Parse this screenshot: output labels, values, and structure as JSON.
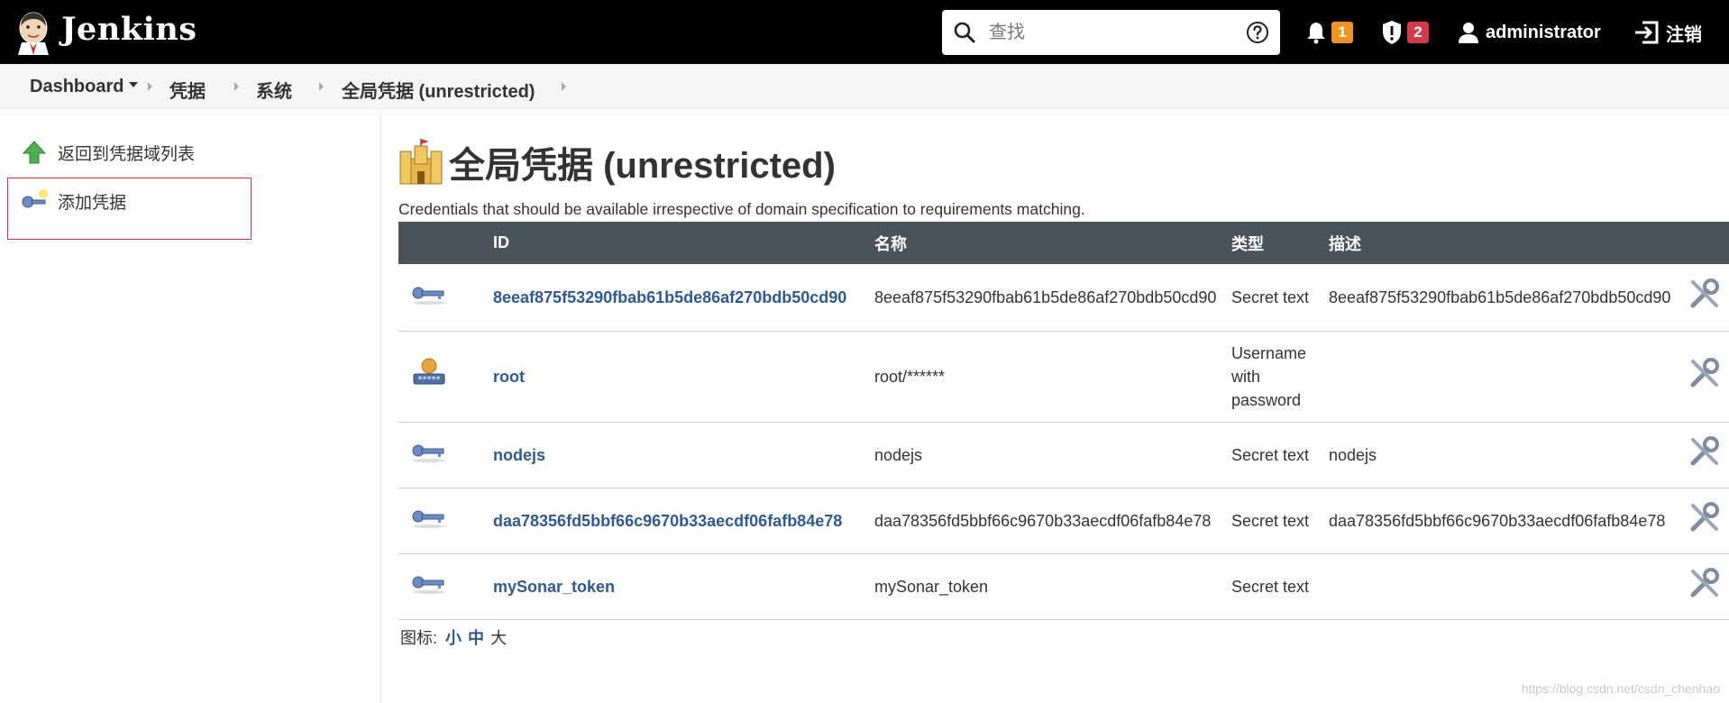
{
  "header": {
    "brand": "Jenkins",
    "search_placeholder": "查找",
    "notifications_count": "1",
    "security_count": "2",
    "user": "administrator",
    "logout": "注销",
    "colors": {
      "bar": "#000000",
      "notif_badge": "#f0931e",
      "security_badge": "#d63a4a"
    }
  },
  "breadcrumb": [
    "Dashboard",
    "凭据",
    "系统",
    "全局凭据 (unrestricted)"
  ],
  "side": {
    "back": "返回到凭据域列表",
    "add": "添加凭据"
  },
  "main": {
    "title": "全局凭据 (unrestricted)",
    "description": "Credentials that should be available irrespective of domain specification to requirements matching.",
    "columns": [
      "ID",
      "名称",
      "类型",
      "描述"
    ],
    "rows": [
      {
        "icon": "key-icon",
        "id": "8eeaf875f53290fbab61b5de86af270bdb50cd90",
        "name": "8eeaf875f53290fbab61b5de86af270bdb50cd90",
        "type": "Secret text",
        "description": "8eeaf875f53290fbab61b5de86af270bdb50cd90"
      },
      {
        "icon": "user-password-icon",
        "id": "root",
        "name": "root/******",
        "type": "Username with password",
        "description": ""
      },
      {
        "icon": "key-icon",
        "id": "nodejs",
        "name": "nodejs",
        "type": "Secret text",
        "description": "nodejs"
      },
      {
        "icon": "key-icon",
        "id": "daa78356fd5bbf66c9670b33aecdf06fafb84e78",
        "name": "daa78356fd5bbf66c9670b33aecdf06fafb84e78",
        "type": "Secret text",
        "description": "daa78356fd5bbf66c9670b33aecdf06fafb84e78"
      },
      {
        "icon": "key-icon",
        "id": "mySonar_token",
        "name": "mySonar_token",
        "type": "Secret text",
        "description": ""
      }
    ],
    "icon_size": {
      "label": "图标:",
      "small": "小",
      "medium": "中",
      "large": "大"
    }
  },
  "watermark": "https://blog.csdn.net/csdn_chenhao"
}
